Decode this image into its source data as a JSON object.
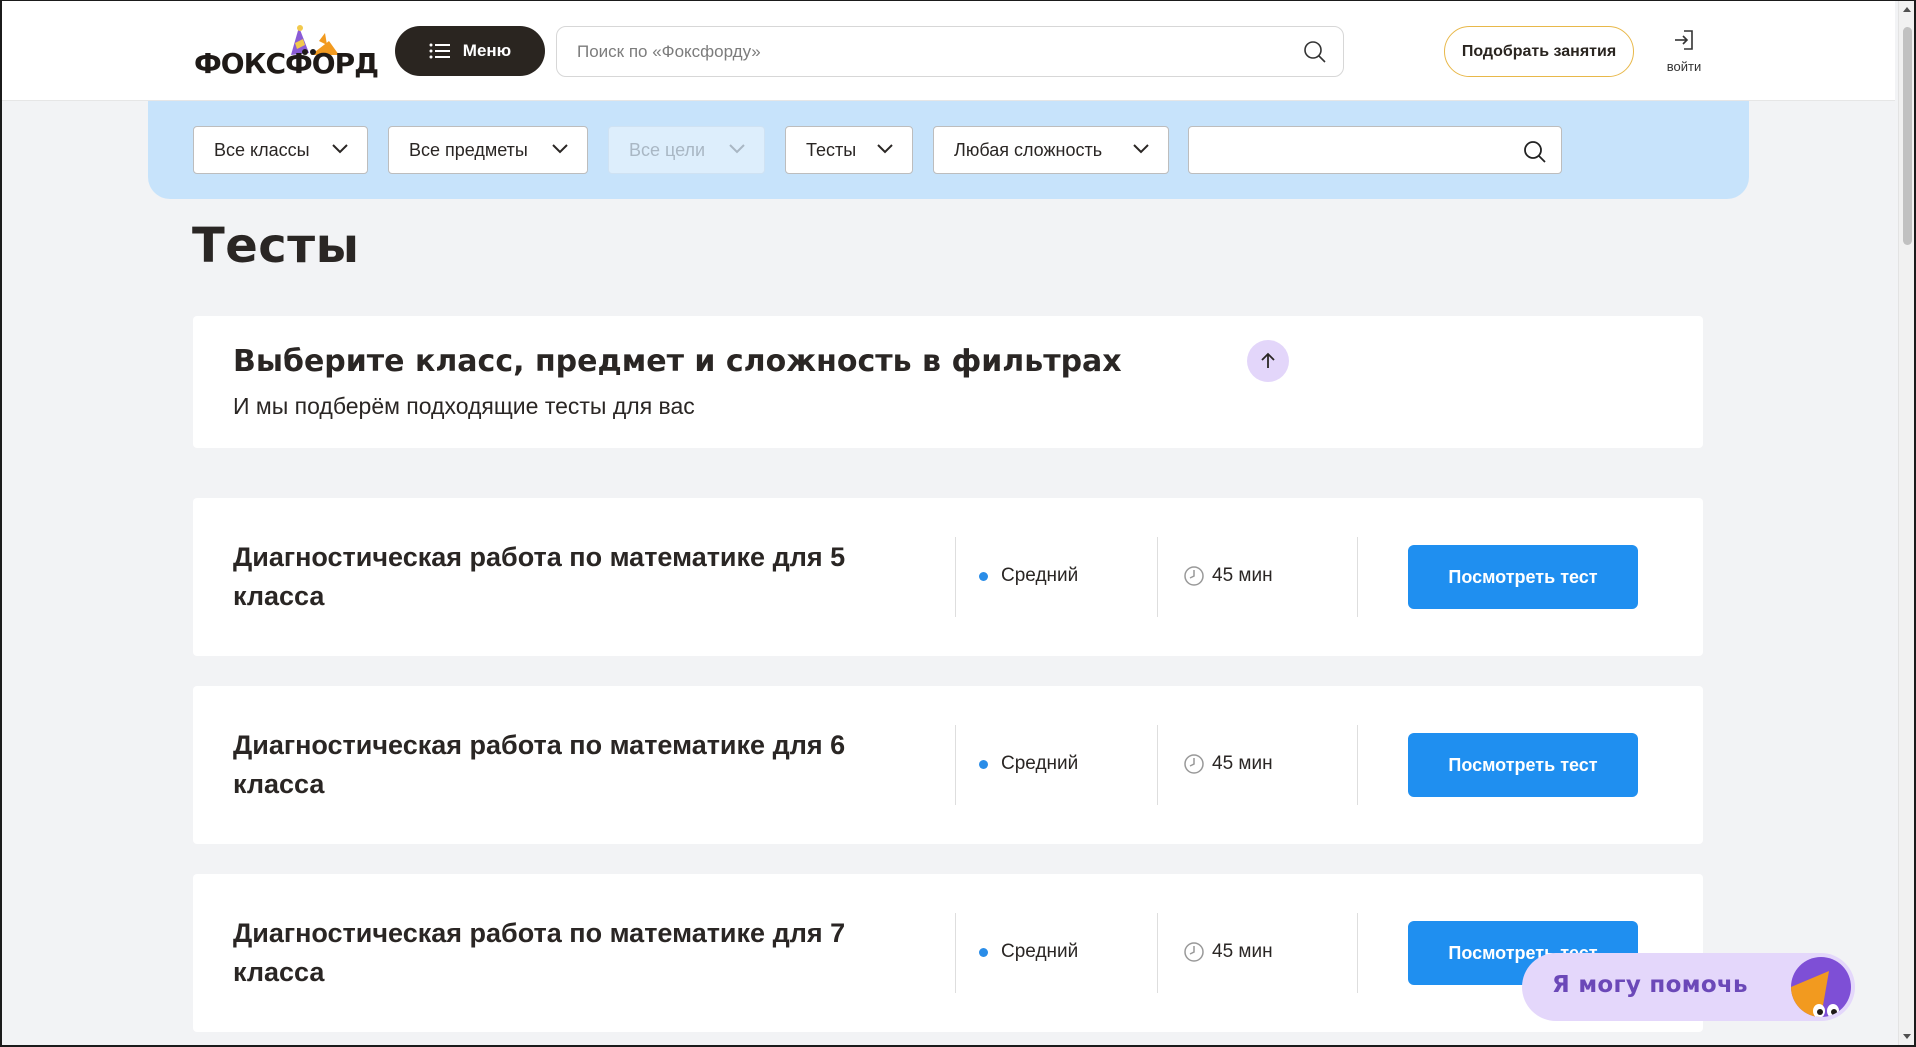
{
  "header": {
    "logo_text": "ФОКСФОРД",
    "menu_label": "Меню",
    "search_placeholder": "Поиск по «Фоксфорду»",
    "pick_label": "Подобрать занятия",
    "login_label": "войти"
  },
  "filters": {
    "grades": "Все классы",
    "subjects": "Все предметы",
    "goals": "Все цели",
    "type": "Тесты",
    "difficulty": "Любая сложность",
    "search_value": ""
  },
  "page": {
    "title": "Тесты",
    "info_title": "Выберите класс, предмет и сложность в фильтрах",
    "info_subtitle": "И мы подберём подходящие тесты для вас"
  },
  "tests": [
    {
      "title": "Диагностическая работа по математике для 5 класса",
      "level": "Средний",
      "duration": "45 мин",
      "button": "Посмотреть тест"
    },
    {
      "title": "Диагностическая работа по математике для 6 класса",
      "level": "Средний",
      "duration": "45 мин",
      "button": "Посмотреть тест"
    },
    {
      "title": "Диагностическая работа по математике для 7 класса",
      "level": "Средний",
      "duration": "45 мин",
      "button": "Посмотреть тест"
    }
  ],
  "helper": {
    "label": "Я могу помочь"
  },
  "colors": {
    "accent_blue": "#1f8ff0",
    "filter_bg": "#c7e3fb",
    "menu_bg": "#2a2520",
    "helper_bg": "#e4d7fb",
    "level_dot": "#2a8de8"
  }
}
